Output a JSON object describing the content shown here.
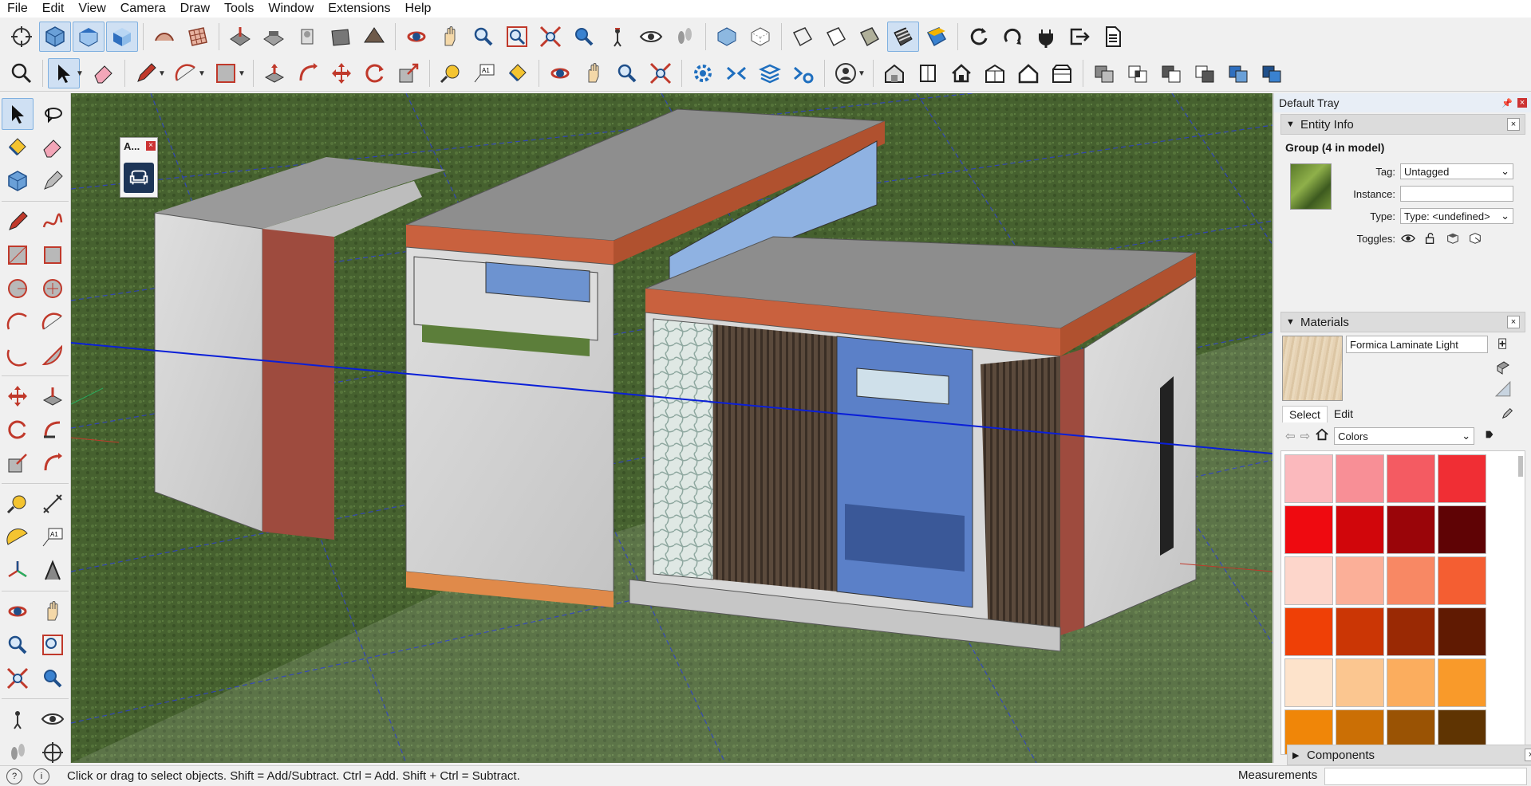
{
  "menu": [
    "File",
    "Edit",
    "View",
    "Camera",
    "Draw",
    "Tools",
    "Window",
    "Extensions",
    "Help"
  ],
  "float_window": {
    "title": "A...",
    "close": "×"
  },
  "tray": {
    "title": "Default Tray",
    "entity_info": {
      "header": "Entity Info",
      "group_label": "Group (4 in model)",
      "tag_label": "Tag:",
      "tag_value": "Untagged",
      "instance_label": "Instance:",
      "instance_value": "",
      "type_label": "Type:",
      "type_value": "Type: <undefined>",
      "toggles_label": "Toggles:"
    },
    "materials": {
      "header": "Materials",
      "name": "Formica Laminate Light",
      "tab_select": "Select",
      "tab_edit": "Edit",
      "collection": "Colors",
      "swatches": [
        "#fbb9bd",
        "#f88f96",
        "#f45b62",
        "#f02e34",
        "#ef0a10",
        "#d1060b",
        "#9a0509",
        "#5f0305",
        "#fdd6cb",
        "#fbaf98",
        "#f88864",
        "#f45e32",
        "#ef4006",
        "#cb3605",
        "#9a2904",
        "#601a02",
        "#fde3cb",
        "#fbc690",
        "#fbad5e",
        "#f99a2a",
        "#f08608",
        "#cb6f05",
        "#9a5304",
        "#5f3402"
      ]
    },
    "components_header": "Components"
  },
  "status": {
    "message": "Click or drag to select objects. Shift = Add/Subtract. Ctrl = Add. Shift + Ctrl = Subtract.",
    "measurements_label": "Measurements"
  },
  "colors": {
    "accent": "#cfe0f3",
    "axis_blue": "#0a1fd8",
    "ground": "#3f5a2a"
  }
}
